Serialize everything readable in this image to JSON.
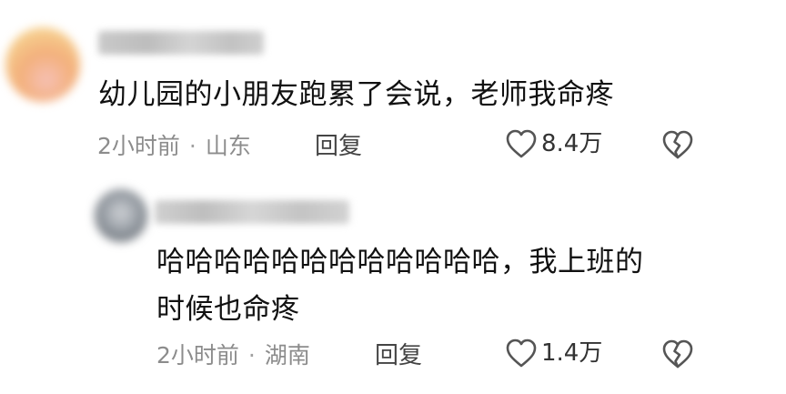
{
  "comments": [
    {
      "text": "幼儿园的小朋友跑累了会说，老师我命疼",
      "time": "2小时前",
      "location": "山东",
      "reply_label": "回复",
      "likes": "8.4万",
      "username_hidden": "blurred"
    }
  ],
  "reply": {
    "text_line1": "哈哈哈哈哈哈哈哈哈哈哈哈，我上班的",
    "text_line2": "时候也命疼",
    "time": "2小时前",
    "location": "湖南",
    "reply_label": "回复",
    "likes": "1.4万",
    "username_hidden": "blurred"
  },
  "icons": {
    "like": "heart-outline-icon",
    "dislike": "broken-heart-icon",
    "separator": "·"
  },
  "colors": {
    "text_primary": "#111111",
    "text_meta": "#8c8c8c",
    "reply_button": "#444444",
    "icon_stroke": "#555555"
  }
}
